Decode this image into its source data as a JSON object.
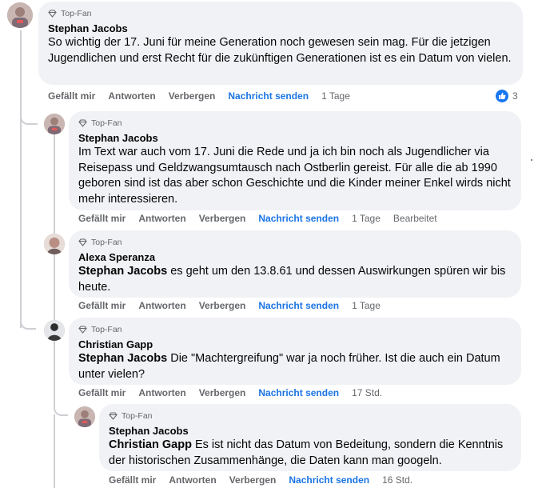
{
  "labels": {
    "badge": "Top-Fan",
    "like": "Gefällt mir",
    "reply": "Antworten",
    "hide": "Verbergen",
    "send_message": "Nachricht senden"
  },
  "comments": [
    {
      "author": "Stephan Jacobs",
      "text": "So wichtig der 17. Juni für meine Generation noch gewesen sein mag. Für die jetzigen Jugendlichen und erst Recht für die zukünftigen Generationen ist es ein Datum von vielen.",
      "time": "1 Tage",
      "reaction_count": "3"
    },
    {
      "author": "Stephan Jacobs",
      "text": "Im Text war auch vom 17. Juni die Rede und ja ich bin noch als Jugendlicher via Reisepass und Geldzwangsumtausch nach Ostberlin gereist. Für alle die ab 1990 geboren sind ist das aber schon Geschichte und die Kinder meiner Enkel wirds nicht mehr interessieren.",
      "time": "1 Tage",
      "edited": "Bearbeitet"
    },
    {
      "author": "Alexa Speranza",
      "mention": "Stephan Jacobs",
      "text": " es geht um den 13.8.61 und dessen Auswirkungen spüren wir bis heute.",
      "time": "1 Tage"
    },
    {
      "author": "Christian Gapp",
      "mention": "Stephan Jacobs",
      "text": " Die \"Machtergreifung\" war ja noch früher. Ist die auch ein Datum unter vielen?",
      "time": "17 Std."
    },
    {
      "author": "Stephan Jacobs",
      "mention": "Christian Gapp",
      "text": " Es ist nicht das Datum von Bedeitung, sondern die Kenntnis der historischen Zusammenhänge, die Daten kann man googeln.",
      "time": "16 Std."
    }
  ]
}
